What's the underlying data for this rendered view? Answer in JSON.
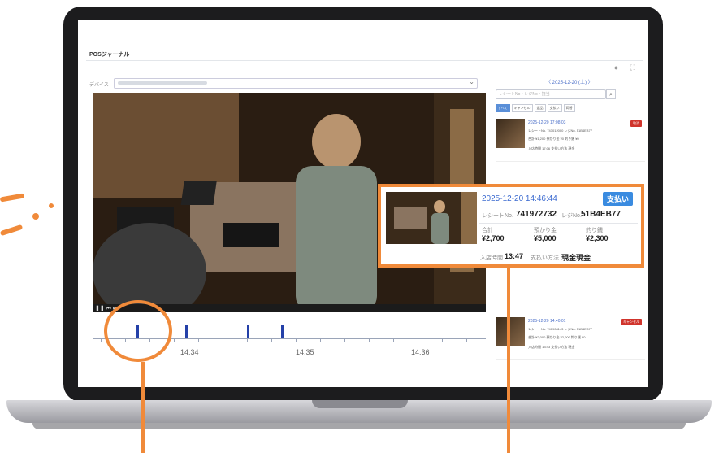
{
  "app": {
    "title": "POSジャーナル",
    "header_icons": "● ⛶",
    "device_label": "デバイス"
  },
  "timeline": {
    "labels": [
      "14:34",
      "14:35",
      "14:36"
    ],
    "controls": "❚❚   ⏮  ⏭"
  },
  "panel": {
    "date_nav": "〈  2025-12-20 (土)  〉",
    "search_placeholder": "レシートNo・レジNo・担当",
    "search_icon": "⌕",
    "filters": [
      "すべて",
      "キャンセル",
      "返品",
      "支払い",
      "両替"
    ],
    "items": [
      {
        "time": "2025-12-20 17:08:03",
        "badge": "取消",
        "row1": "レシートNo. 743012000   レジNo. 51B4EB77",
        "row2": "合計 ¥1,200   預かり金 ¥0   釣り銭 ¥0",
        "row3": "入店時間 17:06   支払い方法 現金"
      },
      {
        "time": "2025-12-20 14:40:01",
        "badge": "キャンセル",
        "row1": "レシートNo. 741908143   レジNo. 51B4EB77",
        "row2": "合計 ¥2,000   預かり金 ¥2,000   釣り銭 ¥0",
        "row3": "入店時間 13:43   支払い方法 現金"
      }
    ]
  },
  "callout": {
    "time": "2025-12-20 14:46:44",
    "badge": "支払い",
    "receipt_label": "レシートNo.",
    "receipt_no": "741972732",
    "register_label": "レジNo.",
    "register_no": "51B4EB77",
    "total_label": "合計",
    "total": "¥2,700",
    "deposit_label": "預かり金",
    "deposit": "¥5,000",
    "change_label": "釣り銭",
    "change": "¥2,300",
    "entry_label": "入店時間",
    "entry_time": "13:47",
    "method_label": "支払い方法",
    "method": "現金現金"
  },
  "colors": {
    "accent_orange": "#f08a3a",
    "link_blue": "#3b6ad0",
    "badge_blue": "#3a8be0",
    "event_blue": "#2440a8",
    "cancel_red": "#d0342c"
  }
}
